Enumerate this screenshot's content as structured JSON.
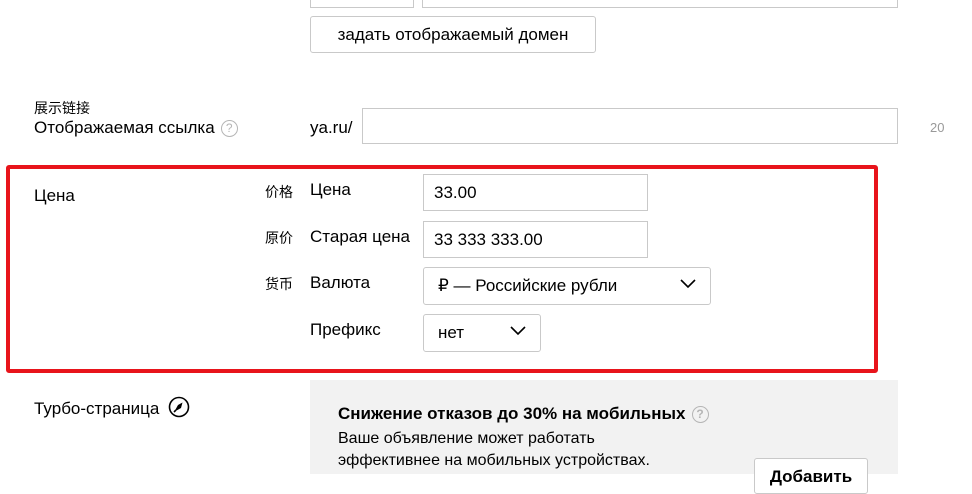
{
  "domain_section": {
    "set_domain_button": "задать отображаемый домен"
  },
  "display_link": {
    "label_zh": "展示链接",
    "label": "Отображаемая ссылка",
    "help_icon": "question-circle-icon",
    "prefix": "ya.ru/",
    "value": "",
    "char_limit": "20"
  },
  "price_section": {
    "title": "Цена",
    "highlight_color": "#e8141b",
    "price": {
      "label_zh": "价格",
      "label": "Цена",
      "value": "33.00"
    },
    "old_price": {
      "label_zh": "原价",
      "label": "Старая цена",
      "value": "33 333 333.00"
    },
    "currency": {
      "label_zh": "货币",
      "label": "Валюта",
      "selected": "₽ — Российские рубли"
    },
    "prefix": {
      "label": "Префикс",
      "selected": "нет"
    }
  },
  "turbo": {
    "label": "Турбо-страница",
    "rocket_icon": "rocket-icon",
    "panel_title": "Снижение отказов до 30% на мобильных",
    "panel_line1": "Ваше объявление может работать",
    "panel_line2": "эффективнее на мобильных устройствах.",
    "add_button": "Добавить"
  }
}
